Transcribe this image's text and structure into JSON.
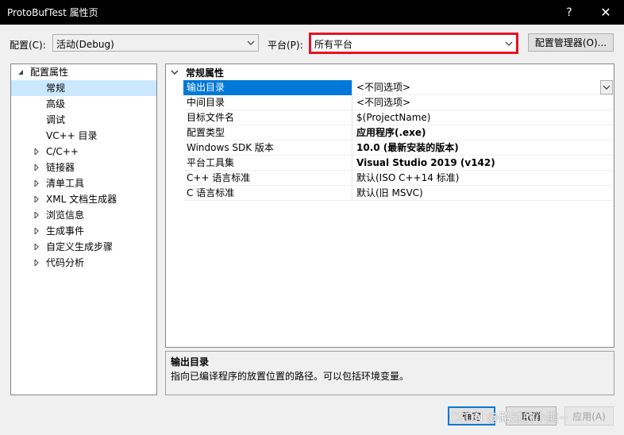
{
  "window": {
    "title": "ProtoBufTest 属性页",
    "help_label": "?",
    "close_label": "✕"
  },
  "toolbar": {
    "config_label": "配置(C):",
    "config_value": "活动(Debug)",
    "platform_label": "平台(P):",
    "platform_value": "所有平台",
    "config_manager_label": "配置管理器(O)..."
  },
  "tree": {
    "root": "配置属性",
    "items": [
      {
        "label": "常规",
        "expandable": false,
        "selected": true
      },
      {
        "label": "高级",
        "expandable": false
      },
      {
        "label": "调试",
        "expandable": false
      },
      {
        "label": "VC++ 目录",
        "expandable": false
      },
      {
        "label": "C/C++",
        "expandable": true
      },
      {
        "label": "链接器",
        "expandable": true
      },
      {
        "label": "清单工具",
        "expandable": true
      },
      {
        "label": "XML 文档生成器",
        "expandable": true
      },
      {
        "label": "浏览信息",
        "expandable": true
      },
      {
        "label": "生成事件",
        "expandable": true
      },
      {
        "label": "自定义生成步骤",
        "expandable": true
      },
      {
        "label": "代码分析",
        "expandable": true
      }
    ]
  },
  "grid": {
    "category": "常规属性",
    "rows": [
      {
        "name": "输出目录",
        "value": "<不同选项>",
        "selected": true
      },
      {
        "name": "中间目录",
        "value": "<不同选项>"
      },
      {
        "name": "目标文件名",
        "value": "$(ProjectName)"
      },
      {
        "name": "配置类型",
        "value": "应用程序(.exe)",
        "bold": true
      },
      {
        "name": "Windows SDK 版本",
        "value": "10.0 (最新安装的版本)",
        "bold": true
      },
      {
        "name": "平台工具集",
        "value": "Visual Studio 2019 (v142)",
        "bold": true
      },
      {
        "name": "C++ 语言标准",
        "value": "默认(ISO C++14 标准)"
      },
      {
        "name": "C 语言标准",
        "value": "默认(旧 MSVC)"
      }
    ]
  },
  "description": {
    "title": "输出目录",
    "text": "指向已编译程序的放置位置的路径。可以包括环境变量。"
  },
  "buttons": {
    "ok": "确定",
    "cancel": "取消",
    "apply": "应用(A)"
  },
  "watermark": "CSDN @路过的小熊~",
  "colors": {
    "highlight_border": "#e81123",
    "selection": "#0078d7",
    "tree_selection": "#cce8ff"
  }
}
